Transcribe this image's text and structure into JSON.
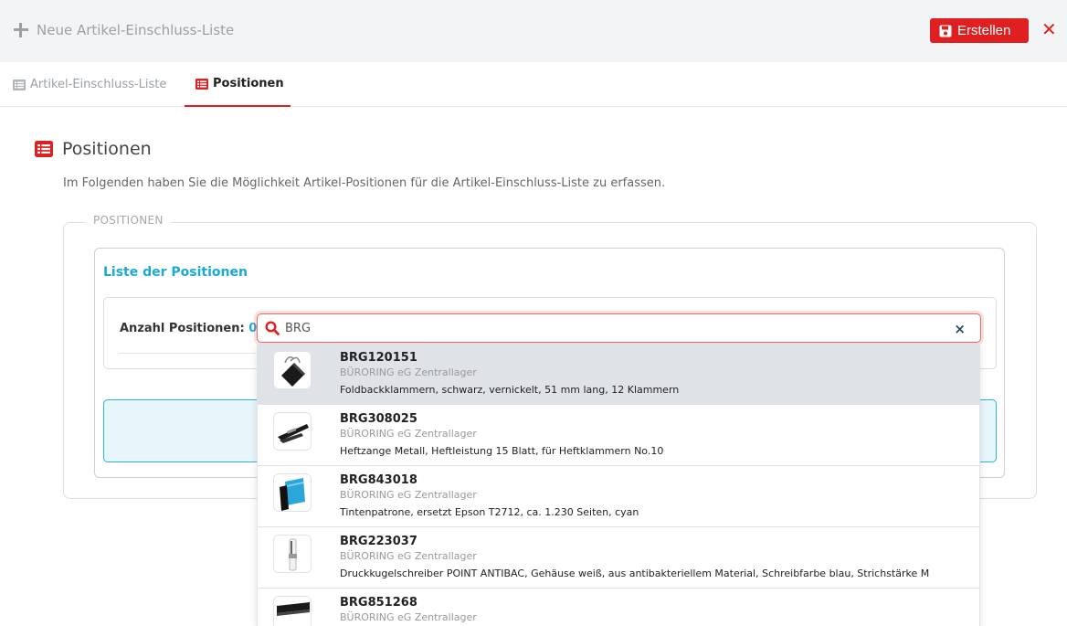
{
  "header": {
    "title": "Neue Artikel-Einschluss-Liste",
    "create_label": "Erstellen",
    "close_label": "✕",
    "accent_color": "#e02020"
  },
  "tabs": [
    {
      "label": "Artikel-Einschluss-Liste",
      "icon": "list-icon",
      "active": false
    },
    {
      "label": "Positionen",
      "icon": "list-icon",
      "active": true
    }
  ],
  "section": {
    "title": "Positionen",
    "description": "Im Folgenden haben Sie die Möglichkeit Artikel-Positionen für die Artikel-Einschluss-Liste zu erfassen.",
    "legend": "POSITIONEN"
  },
  "list": {
    "title": "Liste der Positionen",
    "count_label": "Anzahl Positionen:",
    "count_value": "0"
  },
  "search": {
    "value": "BRG",
    "clear_label": "×"
  },
  "results": [
    {
      "code": "BRG120151",
      "vendor": "BÜRORING eG Zentrallager",
      "description": "Foldbackklammern, schwarz, vernickelt, 51 mm lang, 12 Klammern",
      "icon": "binder-clip-icon",
      "highlighted": true
    },
    {
      "code": "BRG308025",
      "vendor": "BÜRORING eG Zentrallager",
      "description": "Heftzange Metall, Heftleistung 15 Blatt, für Heftklammern No.10",
      "icon": "stapler-icon",
      "highlighted": false
    },
    {
      "code": "BRG843018",
      "vendor": "BÜRORING eG Zentrallager",
      "description": "Tintenpatrone, ersetzt Epson T2712, ca. 1.230 Seiten, cyan",
      "icon": "ink-cartridge-icon",
      "highlighted": false
    },
    {
      "code": "BRG223037",
      "vendor": "BÜRORING eG Zentrallager",
      "description": "Druckkugelschreiber POINT ANTIBAC, Gehäuse weiß, aus antibakteriellem Material, Schreibfarbe blau, Strichstärke M",
      "icon": "pen-icon",
      "highlighted": false
    },
    {
      "code": "BRG851268",
      "vendor": "BÜRORING eG Zentrallager",
      "description": "",
      "icon": "toner-icon",
      "highlighted": false
    }
  ]
}
